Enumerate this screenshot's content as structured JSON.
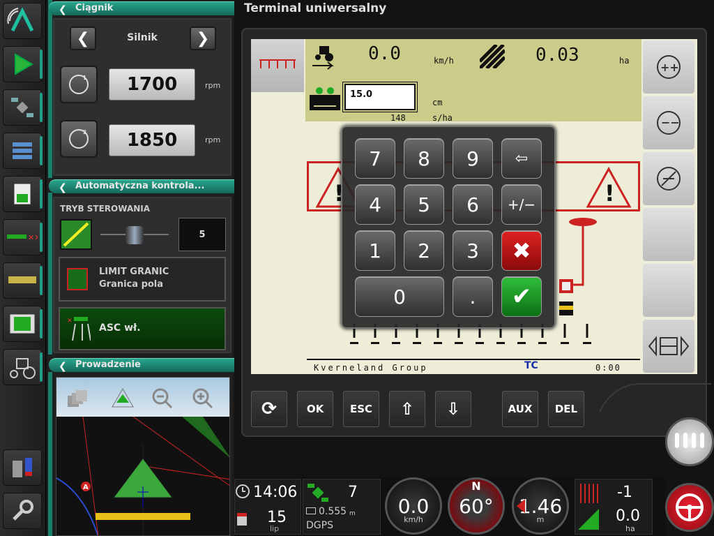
{
  "window_title": "Terminal uniwersalny",
  "tractor_panel": {
    "title": "Ciągnik",
    "nav_label": "Silnik",
    "rpm1": "1700",
    "rpm2": "1850",
    "unit": "rpm"
  },
  "auto_panel": {
    "title": "Automatyczna kontrola...",
    "mode_label": "TRYB STEROWANIA",
    "slider_value": "5",
    "limit_line1": "LIMIT GRANIC",
    "limit_line2": "Granica pola",
    "asc_label": "ASC wł."
  },
  "guidance_panel": {
    "title": "Prowadzenie",
    "marker": "A"
  },
  "vt": {
    "speed": "0.0",
    "speed_unit": "km/h",
    "area": "0.03",
    "area_unit": "ha",
    "input_value": "15.0",
    "depth_unit": "cm",
    "seed_rate": "148",
    "seed_unit": "s/ha",
    "footer_brand": "Kverneland Group",
    "footer_logo": "TC",
    "footer_time": "0:00"
  },
  "keypad": {
    "keys": [
      "7",
      "8",
      "9",
      "⇦",
      "4",
      "5",
      "6",
      "+/−",
      "1",
      "2",
      "3",
      "✖",
      "0",
      ".",
      "✔"
    ]
  },
  "softkeys": {
    "refresh": "⟳",
    "ok": "OK",
    "esc": "ESC",
    "up": "⇧",
    "down": "⇩",
    "aux": "AUX",
    "del": "DEL"
  },
  "status": {
    "time": "14:06",
    "day": "15",
    "month": "lip",
    "satellites": "7",
    "accuracy": "0.555",
    "accuracy_unit": "m",
    "gps_mode": "DGPS",
    "speed": "0.0",
    "speed_unit": "km/h",
    "heading_label": "N",
    "heading": "60°",
    "distance": "1.46",
    "distance_unit": "m",
    "section_value": "-1",
    "area_value": "0.0",
    "area_unit": "ha"
  },
  "colors": {
    "accent_teal": "#1f9d8a",
    "vt_yellow": "#cbcb8a",
    "warn_red": "#cc2222",
    "confirm_green": "#1c9a2a"
  }
}
